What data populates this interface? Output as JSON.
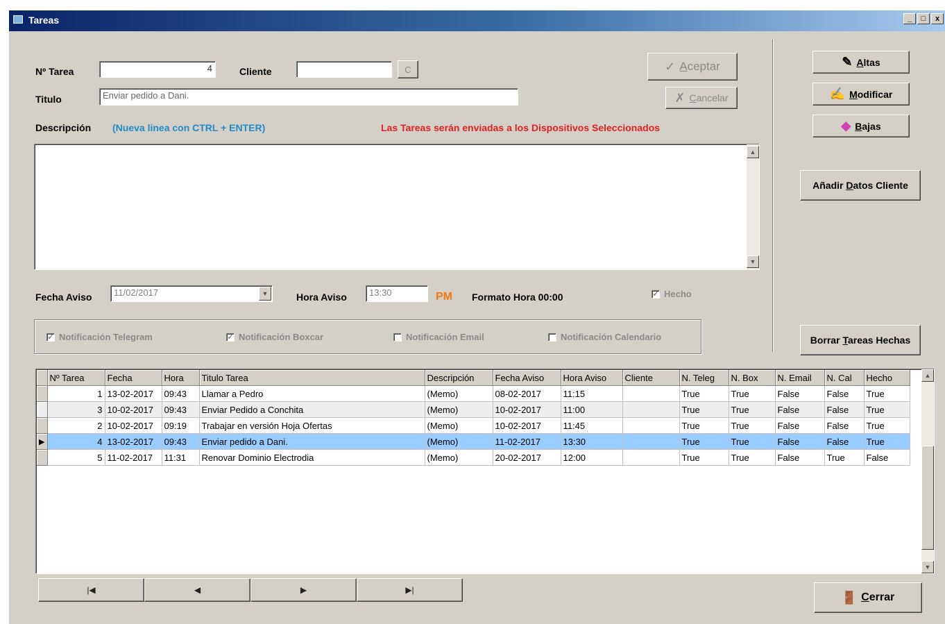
{
  "window": {
    "title": "Tareas",
    "minimize": "_",
    "maximize": "□",
    "close": "x"
  },
  "form": {
    "tarea_label": "Nº Tarea",
    "tarea_value": "4",
    "cliente_label": "Cliente",
    "cliente_value": "",
    "cliente_btn": "C",
    "titulo_label": "Titulo",
    "titulo_value": "Enviar pedido a Dani.",
    "descripcion_label": "Descripción",
    "descripcion_hint": "(Nueva linea con CTRL + ENTER)",
    "warning": "Las Tareas serán enviadas a los Dispositivos Seleccionados",
    "descripcion_value": "",
    "fecha_label": "Fecha Aviso",
    "fecha_value": "11/02/2017",
    "hora_label": "Hora Aviso",
    "hora_value": "13:30",
    "ampm": "PM",
    "formato": "Formato Hora 00:00",
    "hecho_label": "Hecho"
  },
  "actions": {
    "aceptar": {
      "pre": "",
      "u": "A",
      "post": "ceptar"
    },
    "cancelar": {
      "pre": "",
      "u": "C",
      "post": "ancelar"
    },
    "altas": {
      "pre": "",
      "u": "A",
      "post": "ltas"
    },
    "modificar": {
      "pre": "",
      "u": "M",
      "post": "odificar"
    },
    "bajas": {
      "pre": "",
      "u": "B",
      "post": "ajas"
    },
    "datos_cliente": {
      "pre": "Añadir ",
      "u": "D",
      "post": "atos Cliente"
    },
    "borrar": {
      "pre": "Borrar ",
      "u": "T",
      "post": "areas Hechas"
    },
    "cerrar": {
      "pre": "",
      "u": "C",
      "post": "errar"
    }
  },
  "notifications": [
    {
      "label": "Notificación Telegram",
      "checked": true
    },
    {
      "label": "Notificación Boxcar",
      "checked": true
    },
    {
      "label": "Notificación Email",
      "checked": false
    },
    {
      "label": "Notificación Calendario",
      "checked": false
    }
  ],
  "table": {
    "columns": [
      "Nº Tarea",
      "Fecha",
      "Hora",
      "Titulo Tarea",
      "Descripción",
      "Fecha Aviso",
      "Hora Aviso",
      "Cliente",
      "N. Teleg",
      "N. Box",
      "N. Email",
      "N. Cal",
      "Hecho"
    ],
    "rows": [
      {
        "cells": [
          "1",
          "13-02-2017",
          "09:43",
          "Llamar a Pedro",
          "(Memo)",
          "08-02-2017",
          "11:15",
          "",
          "True",
          "True",
          "False",
          "False",
          "True"
        ],
        "selected": false
      },
      {
        "cells": [
          "3",
          "10-02-2017",
          "09:43",
          "Enviar Pedido a Conchita",
          "(Memo)",
          "10-02-2017",
          "11:00",
          "",
          "True",
          "True",
          "False",
          "False",
          "True"
        ],
        "selected": false
      },
      {
        "cells": [
          "2",
          "10-02-2017",
          "09:19",
          "Trabajar en versión Hoja Ofertas",
          "(Memo)",
          "10-02-2017",
          "11:45",
          "",
          "True",
          "True",
          "False",
          "False",
          "True"
        ],
        "selected": false
      },
      {
        "cells": [
          "4",
          "13-02-2017",
          "09:43",
          "Enviar pedido a Dani.",
          "(Memo)",
          "11-02-2017",
          "13:30",
          "",
          "True",
          "True",
          "False",
          "False",
          "True"
        ],
        "selected": true
      },
      {
        "cells": [
          "5",
          "11-02-2017",
          "11:31",
          "Renovar Dominio Electrodia",
          "(Memo)",
          "20-02-2017",
          "12:00",
          "",
          "True",
          "True",
          "False",
          "True",
          "False"
        ],
        "selected": false
      }
    ]
  },
  "navigator": [
    {
      "name": "first-record-button",
      "glyph": "|◀"
    },
    {
      "name": "prior-record-button",
      "glyph": "◀"
    },
    {
      "name": "next-record-button",
      "glyph": "▶"
    },
    {
      "name": "last-record-button",
      "glyph": "▶|"
    }
  ],
  "colors": {
    "hint": "#1f8ac8",
    "warning": "#e02020",
    "ampm": "#f07a10",
    "selection": "#99ccff",
    "titlebar": "#0a246a"
  },
  "icons": {
    "aceptar": "checkmark-icon",
    "cancelar": "cross-icon",
    "altas": "pencil-icon",
    "modificar": "edit-icon",
    "bajas": "eraser-icon",
    "cerrar": "door-exit-icon"
  }
}
